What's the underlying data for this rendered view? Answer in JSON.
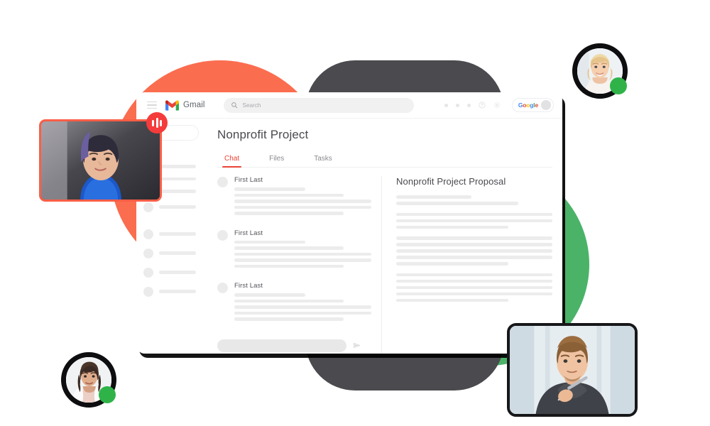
{
  "colors": {
    "coral": "#FB6D4F",
    "green": "#4AB368",
    "charcoal": "#4A4A4F",
    "accent_red": "#EA4335",
    "online_green": "#2FB348",
    "speaking_red": "#F53B3B",
    "skeleton_gray": "#ECECEC"
  },
  "window": {
    "header": {
      "menu_icon": "hamburger-icon",
      "brand": "Gmail",
      "brand_logo_icon": "gmail-m-logo-icon",
      "search": {
        "icon": "search-icon",
        "placeholder": "Search",
        "value": ""
      },
      "dots": [
        "dot-1",
        "dot-2",
        "dot-3"
      ],
      "help_icon": "help-circle-icon",
      "settings_icon": "gear-icon",
      "google_badge": {
        "word": "Google",
        "letters": [
          "G",
          "o",
          "o",
          "g",
          "l",
          "e"
        ],
        "avatar_icon": "account-avatar-icon"
      }
    },
    "sidebar": {
      "compose_label": "",
      "nav_lines": 4,
      "contact_rows": 5
    },
    "page_title": "Nonprofit Project",
    "tabs": [
      {
        "label": "Chat",
        "active": true
      },
      {
        "label": "Files",
        "active": false
      },
      {
        "label": "Tasks",
        "active": false
      }
    ],
    "chat": {
      "messages": [
        {
          "name": "First Last",
          "avatar_icon": "contact-avatar-icon",
          "line_widths": [
            "52%",
            "80%",
            "100%",
            "100%",
            "80%"
          ]
        },
        {
          "name": "First Last",
          "avatar_icon": "contact-avatar-icon",
          "line_widths": [
            "52%",
            "80%",
            "100%",
            "100%",
            "80%"
          ]
        },
        {
          "name": "First Last",
          "avatar_icon": "contact-avatar-icon",
          "line_widths": [
            "52%",
            "80%",
            "100%",
            "100%",
            "80%"
          ]
        }
      ],
      "composer": {
        "placeholder": "",
        "value": "",
        "send_icon": "send-paper-plane-icon"
      }
    },
    "document": {
      "title": "Nonprofit Project Proposal",
      "paragraphs": [
        [
          "48%",
          "78%"
        ],
        [
          "100%",
          "100%",
          "72%"
        ],
        [
          "100%",
          "100%",
          "100%",
          "100%",
          "72%"
        ],
        [
          "100%",
          "100%",
          "100%",
          "100%",
          "72%"
        ]
      ]
    }
  },
  "video_tiles": [
    {
      "id": "tile-left",
      "participant_icon": "video-participant-icon",
      "border_color": "#FB5E46",
      "speaking_badge": {
        "icon": "audio-bars-icon",
        "color": "#F53B3B"
      }
    },
    {
      "id": "tile-right",
      "participant_icon": "video-participant-icon",
      "border_color": "#17171A"
    }
  ],
  "participant_avatars": [
    {
      "id": "avatar-top-right",
      "photo_icon": "participant-photo-icon",
      "status": "online",
      "status_color": "#2FB348"
    },
    {
      "id": "avatar-bottom-left",
      "photo_icon": "participant-photo-icon",
      "status": "online",
      "status_color": "#2FB348"
    }
  ]
}
